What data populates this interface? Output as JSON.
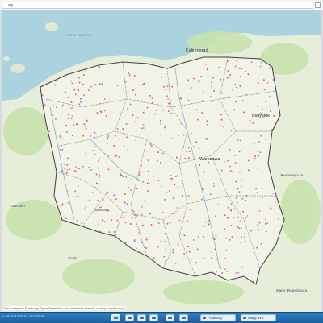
{
  "search": {
    "value": "...wy"
  },
  "map": {
    "places": {
      "kaliningrad": "Kaliningrad",
      "bialystok": "Białystok",
      "warszawa": "Warszawa",
      "dresden": "Dresden",
      "wroclaw": "Wrocław",
      "cesko": "Česko",
      "zhytomyr": "Житомирська",
      "ivano": "Івано-Франківська",
      "baltic": "Morze Bałtyckie"
    }
  },
  "attribution": "Dane mapowe © autorzy OpenStreetMap, na podstawie danych z mapy turystycznej",
  "coords": "X: 654714.022; Y: -167232.55",
  "toolbar": {
    "buttons": [
      "layers",
      "measure",
      "select",
      "print",
      "ruler",
      "share"
    ],
    "legend_label": "Podkłady",
    "maps_label": "Mapy WS"
  },
  "colors": {
    "water": "#aad3df",
    "land": "#e8eede",
    "forest": "#cde6b3",
    "border": "#4a4a4a",
    "accent": "#1f6fb5"
  }
}
